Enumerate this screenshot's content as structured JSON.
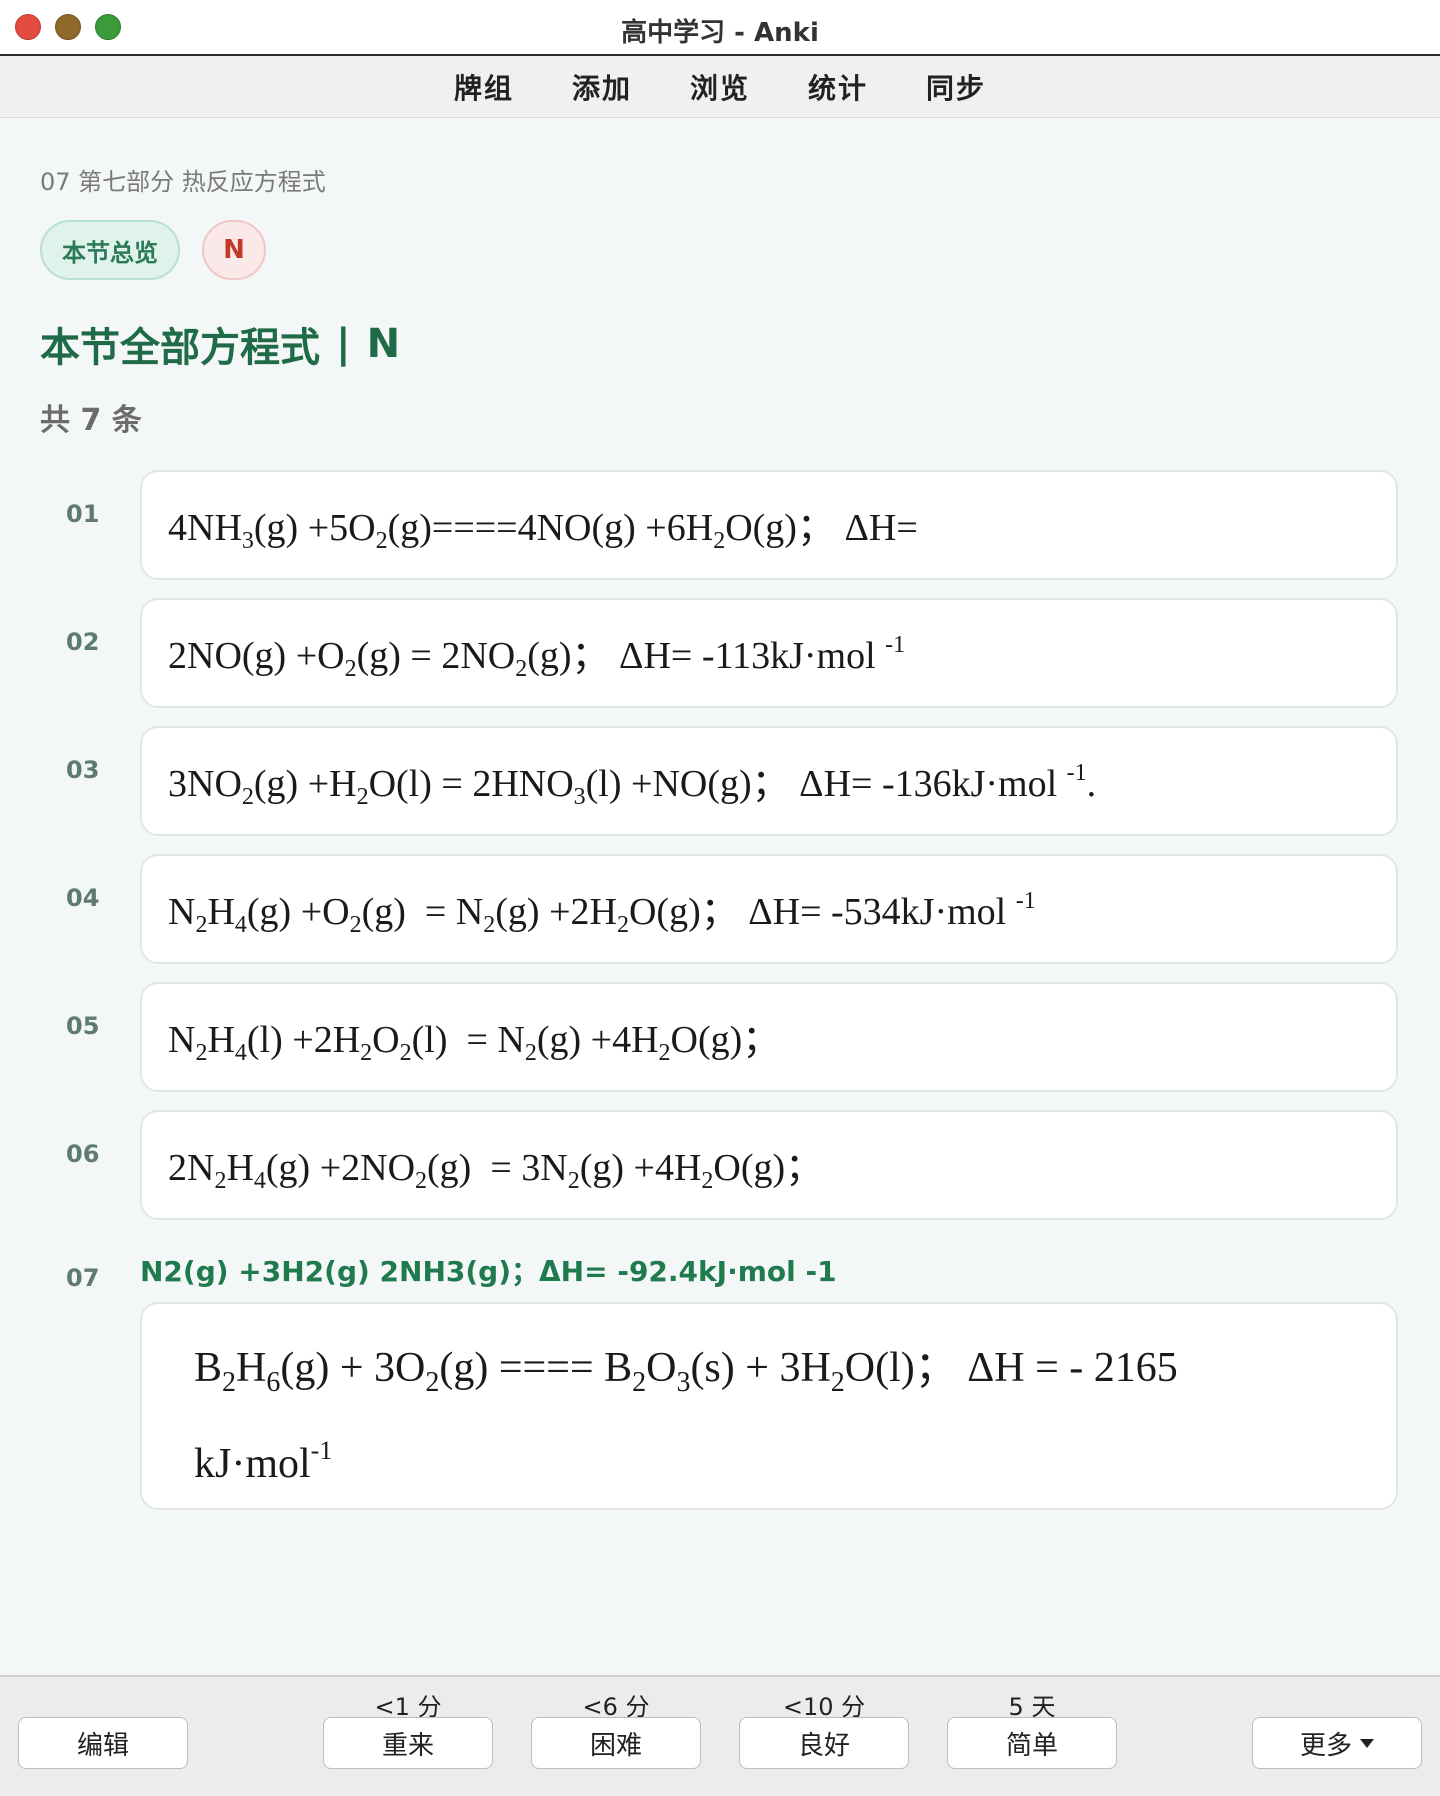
{
  "window": {
    "title": "高中学习 - Anki"
  },
  "toolbar": {
    "items": [
      "牌组",
      "添加",
      "浏览",
      "统计",
      "同步"
    ]
  },
  "card": {
    "section": "07 第七部分 热反应方程式",
    "tag_overview": "本节总览",
    "tag_n": "N",
    "heading_main": "本节全部方程式",
    "heading_sep": "|",
    "heading_tag": "N",
    "count": "共 7 条",
    "equations": [
      {
        "num": "01"
      },
      {
        "num": "02"
      },
      {
        "num": "03"
      },
      {
        "num": "04"
      },
      {
        "num": "05"
      },
      {
        "num": "06"
      },
      {
        "num": "07",
        "label": "N2(g) +3H2(g) 2NH3(g)；ΔH= -92.4kJ·mol -1"
      }
    ]
  },
  "bottom": {
    "edit": "编辑",
    "again": {
      "label": "重来",
      "interval": "<1 分"
    },
    "hard": {
      "label": "困难",
      "interval": "<6 分"
    },
    "good": {
      "label": "良好",
      "interval": "<10 分"
    },
    "easy": {
      "label": "简单",
      "interval": "5 天"
    },
    "more": "更多"
  }
}
